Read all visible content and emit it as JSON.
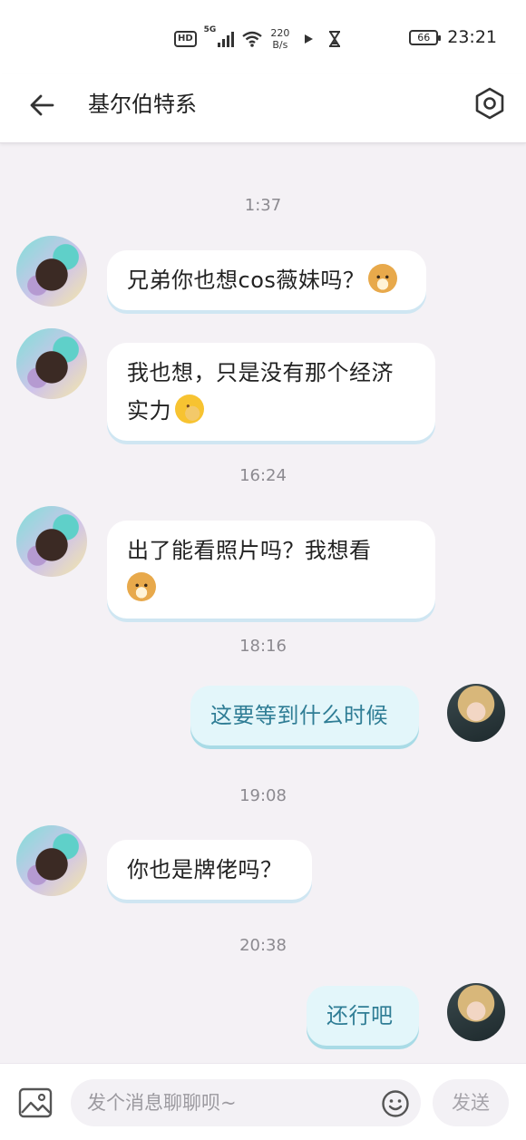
{
  "status_bar": {
    "hd": "HD",
    "network": "5G",
    "speed_value": "220",
    "speed_unit": "B/s",
    "battery": "66",
    "time": "23:21"
  },
  "header": {
    "title": "基尔伯特系"
  },
  "messages": [
    {
      "type": "timestamp",
      "text": "1:37"
    },
    {
      "type": "incoming",
      "text": "兄弟你也想cos薇妹吗？",
      "emoji": "doge-emoji"
    },
    {
      "type": "incoming",
      "text_line1": "我也想，只是没有那个经济",
      "text_line2": "实力",
      "emoji": "facepalm-emoji"
    },
    {
      "type": "timestamp",
      "text": "16:24"
    },
    {
      "type": "incoming",
      "text_line1": "出了能看照片吗？我想看",
      "emoji": "doge-emoji"
    },
    {
      "type": "timestamp",
      "text": "18:16"
    },
    {
      "type": "outgoing",
      "text": "这要等到什么时候"
    },
    {
      "type": "timestamp",
      "text": "19:08"
    },
    {
      "type": "incoming",
      "text": "你也是牌佬吗？"
    },
    {
      "type": "timestamp",
      "text": "20:38"
    },
    {
      "type": "outgoing",
      "text": "还行吧"
    }
  ],
  "input_bar": {
    "placeholder": "发个消息聊聊呗~",
    "send_label": "发送"
  },
  "colors": {
    "background": "#f4f1f5",
    "incoming_bubble": "#ffffff",
    "outgoing_bubble": "#e3f6fa",
    "outgoing_text": "#2f7d95"
  },
  "icons": [
    "back-arrow-icon",
    "settings-hexagon-icon",
    "image-icon",
    "emoji-icon",
    "wifi-icon",
    "play-icon",
    "hourglass-icon"
  ]
}
